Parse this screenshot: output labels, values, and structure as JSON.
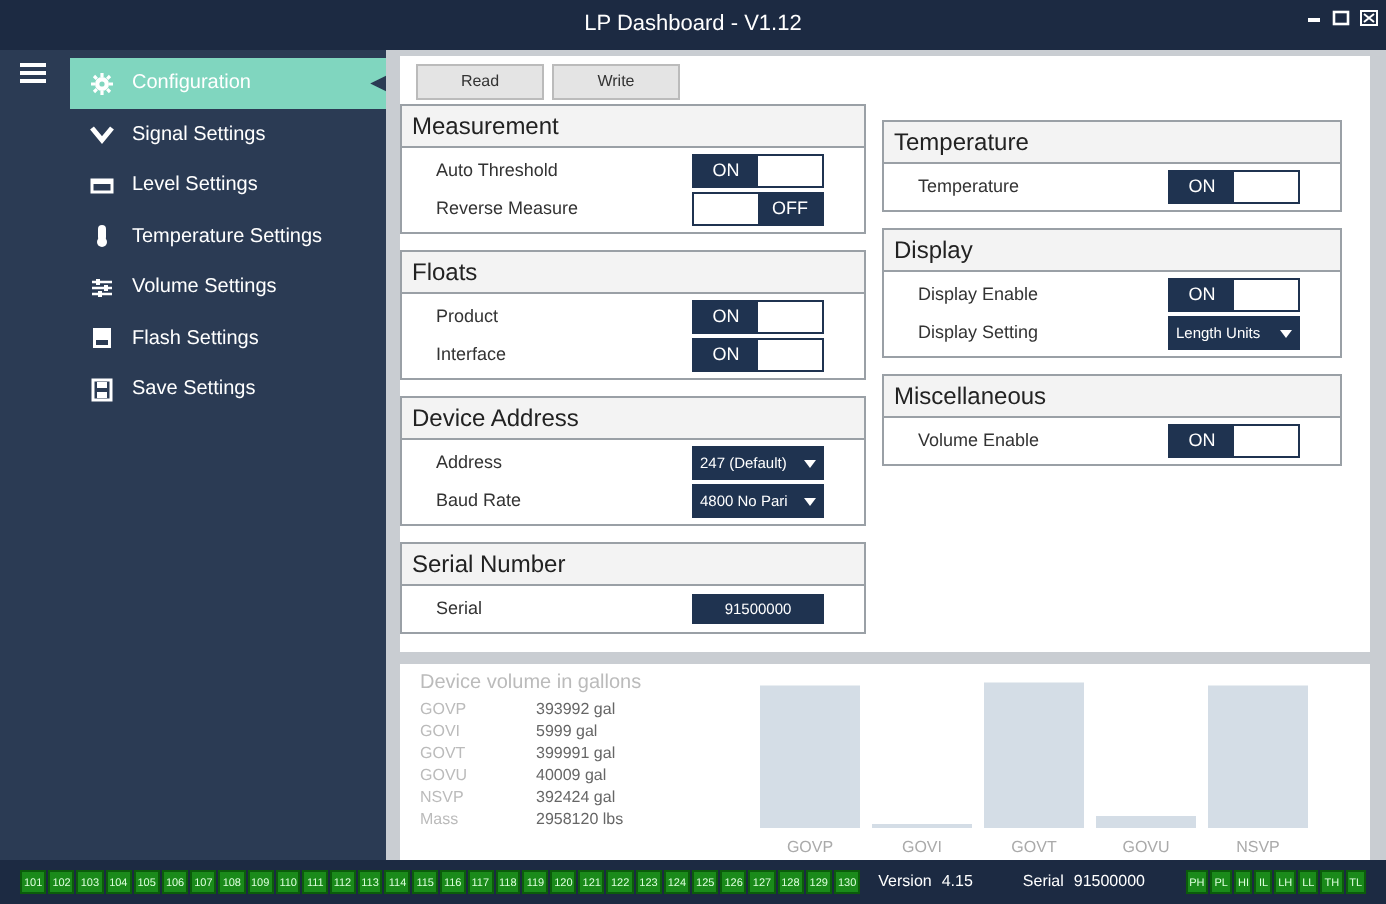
{
  "window": {
    "title": "LP Dashboard - V1.12"
  },
  "sidebar": {
    "items": [
      {
        "label": "Configuration",
        "selected": true
      },
      {
        "label": "Signal Settings",
        "selected": false
      },
      {
        "label": "Level Settings",
        "selected": false
      },
      {
        "label": "Temperature Settings",
        "selected": false
      },
      {
        "label": "Volume Settings",
        "selected": false
      },
      {
        "label": "Flash Settings",
        "selected": false
      },
      {
        "label": "Save Settings",
        "selected": false
      }
    ]
  },
  "toolbar": {
    "buttons": [
      "Read",
      "Write"
    ]
  },
  "left_groups": [
    {
      "title": "Measurement",
      "rows": [
        {
          "label": "Auto Threshold",
          "kind": "toggle",
          "on": true,
          "text": "ON"
        },
        {
          "label": "Reverse Measure",
          "kind": "toggle",
          "on": false,
          "text": "OFF"
        }
      ]
    },
    {
      "title": "Floats",
      "rows": [
        {
          "label": "Product",
          "kind": "toggle",
          "on": true,
          "text": "ON"
        },
        {
          "label": "Interface",
          "kind": "toggle",
          "on": true,
          "text": "ON"
        }
      ]
    },
    {
      "title": "Device Address",
      "rows": [
        {
          "label": "Address",
          "kind": "dropdown",
          "text": "247 (Default)"
        },
        {
          "label": "Baud Rate",
          "kind": "dropdown",
          "text": "4800 No Pari"
        }
      ]
    },
    {
      "title": "Serial Number",
      "rows": [
        {
          "label": "Serial",
          "kind": "value",
          "text": "91500000"
        }
      ]
    }
  ],
  "right_groups": [
    {
      "title": "Temperature",
      "rows": [
        {
          "label": "Temperature",
          "kind": "toggle",
          "on": true,
          "text": "ON"
        }
      ]
    },
    {
      "title": "Display",
      "rows": [
        {
          "label": "Display Enable",
          "kind": "toggle",
          "on": true,
          "text": "ON"
        },
        {
          "label": "Display Setting",
          "kind": "dropdown",
          "text": "Length Units"
        }
      ]
    },
    {
      "title": "Miscellaneous",
      "rows": [
        {
          "label": "Volume Enable",
          "kind": "toggle",
          "on": true,
          "text": "ON"
        }
      ]
    }
  ],
  "volume": {
    "title": "Device volume in gallons",
    "rows": [
      {
        "name": "GOVP",
        "value": "393992 gal"
      },
      {
        "name": "GOVI",
        "value": "5999 gal"
      },
      {
        "name": "GOVT",
        "value": "399991 gal"
      },
      {
        "name": "GOVU",
        "value": "40009 gal"
      },
      {
        "name": "NSVP",
        "value": "392424 gal"
      },
      {
        "name": "Mass",
        "value": "2958120 lbs"
      }
    ],
    "bar_labels": [
      "GOVP",
      "GOVI",
      "GOVT",
      "GOVU",
      "NSVP"
    ]
  },
  "status_bar": {
    "channels": [
      "101",
      "102",
      "103",
      "104",
      "105",
      "106",
      "107",
      "108",
      "109",
      "110",
      "111",
      "112",
      "113",
      "114",
      "115",
      "116",
      "117",
      "118",
      "119",
      "120",
      "121",
      "122",
      "123",
      "124",
      "125",
      "126",
      "127",
      "128",
      "129",
      "130"
    ],
    "version_label": "Version",
    "version": "4.15",
    "serial_label": "Serial",
    "serial": "91500000",
    "alarms": [
      "PH",
      "PL",
      "HI",
      "IL",
      "LH",
      "LL",
      "TH",
      "TL"
    ]
  }
}
